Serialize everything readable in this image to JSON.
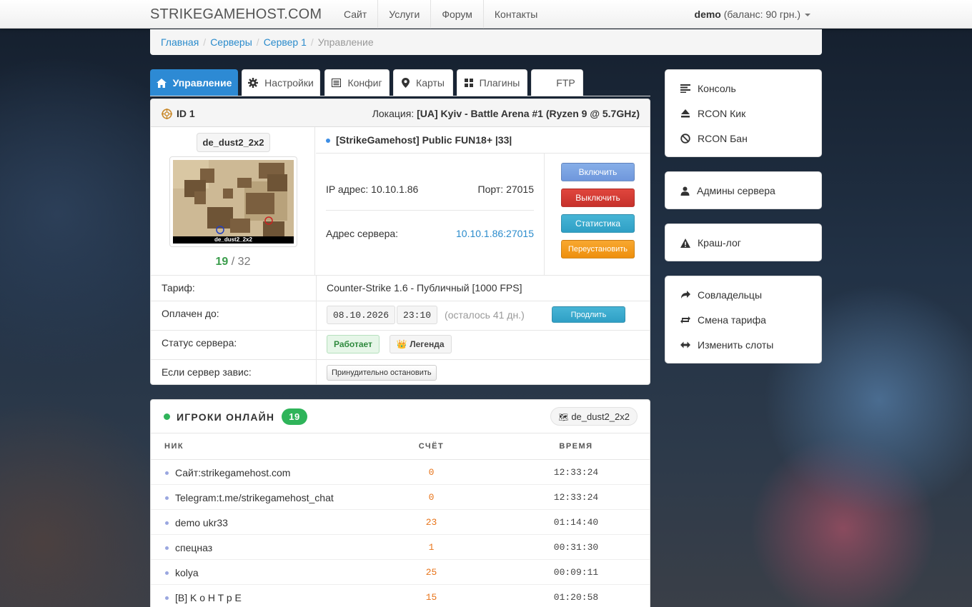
{
  "header": {
    "brand": "STRIKEGAMEHOST.COM",
    "nav": [
      "Сайт",
      "Услуги",
      "Форум",
      "Контакты"
    ],
    "user_name": "demo",
    "user_balance": "(баланс: 90 грн.)"
  },
  "breadcrumb": [
    "Главная",
    "Серверы",
    "Сервер 1",
    "Управление"
  ],
  "tabs": [
    {
      "label": "Управление",
      "icon": "home-icon",
      "active": true
    },
    {
      "label": "Настройки",
      "icon": "gear-icon"
    },
    {
      "label": "Конфиг",
      "icon": "list-icon"
    },
    {
      "label": "Карты",
      "icon": "map-marker-icon"
    },
    {
      "label": "Плагины",
      "icon": "grid-icon"
    },
    {
      "label": "FTP",
      "icon": ""
    }
  ],
  "server": {
    "id_label": "ID 1",
    "location_label": "Локация:",
    "location_value": "[UA] Kyiv - Battle Arena #1 (Ryzen 9 @ 5.7GHz)",
    "map": "de_dust2_2x2",
    "map_image_label": "de_dust2_2x2",
    "players_current": "19",
    "players_max": "/ 32",
    "name": "[StrikeGamehost] Public FUN18+ |33|",
    "ip_label": "IP адрес:",
    "ip": "10.10.1.86",
    "port_label": "Порт:",
    "port": "27015",
    "address_label": "Адрес сервера:",
    "address": "10.10.1.86:27015",
    "buttons": {
      "start": "Включить",
      "stop": "Выключить",
      "stats": "Статистика",
      "reinstall": "Переустановить"
    },
    "tariff_label": "Тариф:",
    "tariff": "Counter-Strike 1.6 - Публичный [1000 FPS]",
    "paid_label": "Оплачен до:",
    "paid_date": "08.10.2026",
    "paid_time": "23:10",
    "paid_left": "(осталось 41 дн.)",
    "prolong": "Продлить",
    "status_label": "Статус сервера:",
    "status": "Работает",
    "rank": "Легенда",
    "freeze_label": "Если сервер завис:",
    "force_stop": "Принудительно остановить"
  },
  "sidebar": {
    "group1": [
      "Консоль",
      "RCON Кик",
      "RCON Бан"
    ],
    "group2": [
      "Админы сервера"
    ],
    "group3": [
      "Краш-лог"
    ],
    "group4": [
      "Совладельцы",
      "Смена тарифа",
      "Изменить слоты"
    ]
  },
  "players": {
    "title": "ИГРОКИ ОНЛАЙН",
    "count": "19",
    "map": "de_dust2_2x2",
    "columns": [
      "НИК",
      "СЧЁТ",
      "ВРЕМЯ"
    ],
    "rows": [
      {
        "nick": "Сайт:strikegamehost.com",
        "score": "0",
        "time": "12:33:24"
      },
      {
        "nick": "Telegram:t.me/strikegamehost_chat",
        "score": "0",
        "time": "12:33:24"
      },
      {
        "nick": "demo ukr33",
        "score": "23",
        "time": "01:14:40"
      },
      {
        "nick": "спецназ",
        "score": "1",
        "time": "00:31:30"
      },
      {
        "nick": "kolya",
        "score": "25",
        "time": "00:09:11"
      },
      {
        "nick": "[B] K o H T p E",
        "score": "15",
        "time": "01:20:58"
      }
    ]
  },
  "colors": {
    "accent": "#2d8ad4",
    "success": "#2fb45a",
    "danger": "#c6312b",
    "warning": "#ee8f0d",
    "info": "#2f9fc5"
  }
}
